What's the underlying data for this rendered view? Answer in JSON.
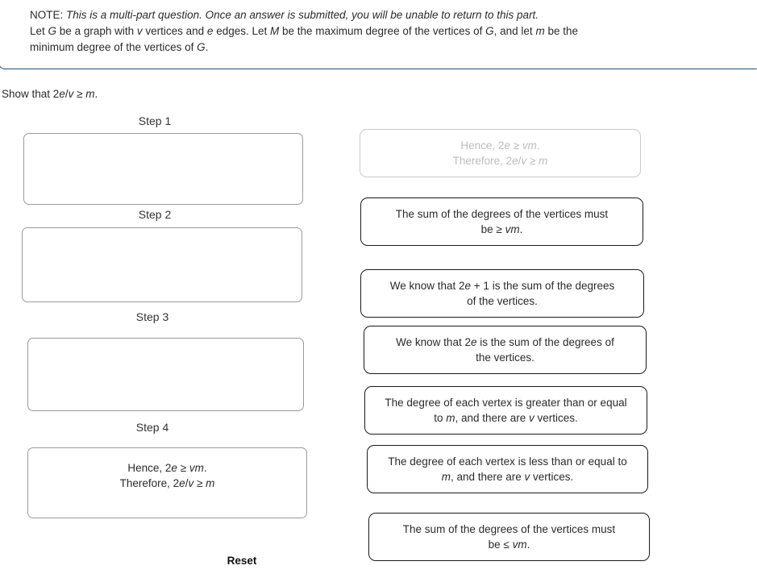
{
  "note": {
    "prefix": "NOTE:",
    "line1": "This is a multi-part question. Once an answer is submitted, you will be unable to return to this part.",
    "line2_part1": "Let ",
    "line2_var1": "G",
    "line2_part2": " be a graph with ",
    "line2_var2": "v",
    "line2_part3": " vertices and ",
    "line2_var3": "e",
    "line2_part4": " edges. Let ",
    "line2_var4": "M",
    "line2_part5": " be the maximum degree of the vertices of ",
    "line2_var5": "G",
    "line2_part6": ", and let ",
    "line2_var6": "m",
    "line2_part7": " be the",
    "line3_part1": "minimum degree of the vertices of ",
    "line3_var1": "G",
    "line3_part2": ".",
    "border_color": "#1f4e79"
  },
  "prompt": {
    "lead": "Show that ",
    "expr_num": "2",
    "expr_e": "e",
    "expr_slash": "/",
    "expr_v": "v",
    "expr_rel": " ≥ ",
    "expr_m": "m",
    "expr_end": "."
  },
  "steps": [
    {
      "label": "Step 1",
      "content_line1": "",
      "content_line2": "",
      "filled": false
    },
    {
      "label": "Step 2",
      "content_line1": "",
      "content_line2": "",
      "filled": false
    },
    {
      "label": "Step 3",
      "content_line1": "",
      "content_line2": "",
      "filled": false
    },
    {
      "label": "Step 4",
      "content_line1": "Hence, 2e ≥ vm.",
      "content_line2": "Therefore, 2e/v ≥ m",
      "filled": true
    }
  ],
  "reset": {
    "label": "Reset"
  },
  "options": [
    {
      "line1": "Hence, 2e ≥ vm.",
      "line2": "Therefore, 2e/v ≥ m",
      "used": true
    },
    {
      "line1": "The sum of the degrees of the vertices must",
      "line2": "be ≥ vm.",
      "used": false
    },
    {
      "line1": "We know that 2e + 1 is the sum of the degrees",
      "line2": "of the vertices.",
      "used": false
    },
    {
      "line1": "We know that 2e is the sum of the degrees of",
      "line2": "the vertices.",
      "used": false
    },
    {
      "line1": "The degree of each vertex is greater than or equal",
      "line2": "to m, and there are v vertices.",
      "used": false
    },
    {
      "line1": "The degree of each vertex is less than or equal to",
      "line2": "m, and there are v vertices.",
      "used": false
    },
    {
      "line1": "The sum of the degrees of the vertices must",
      "line2": "be ≤ vm.",
      "used": false
    }
  ]
}
